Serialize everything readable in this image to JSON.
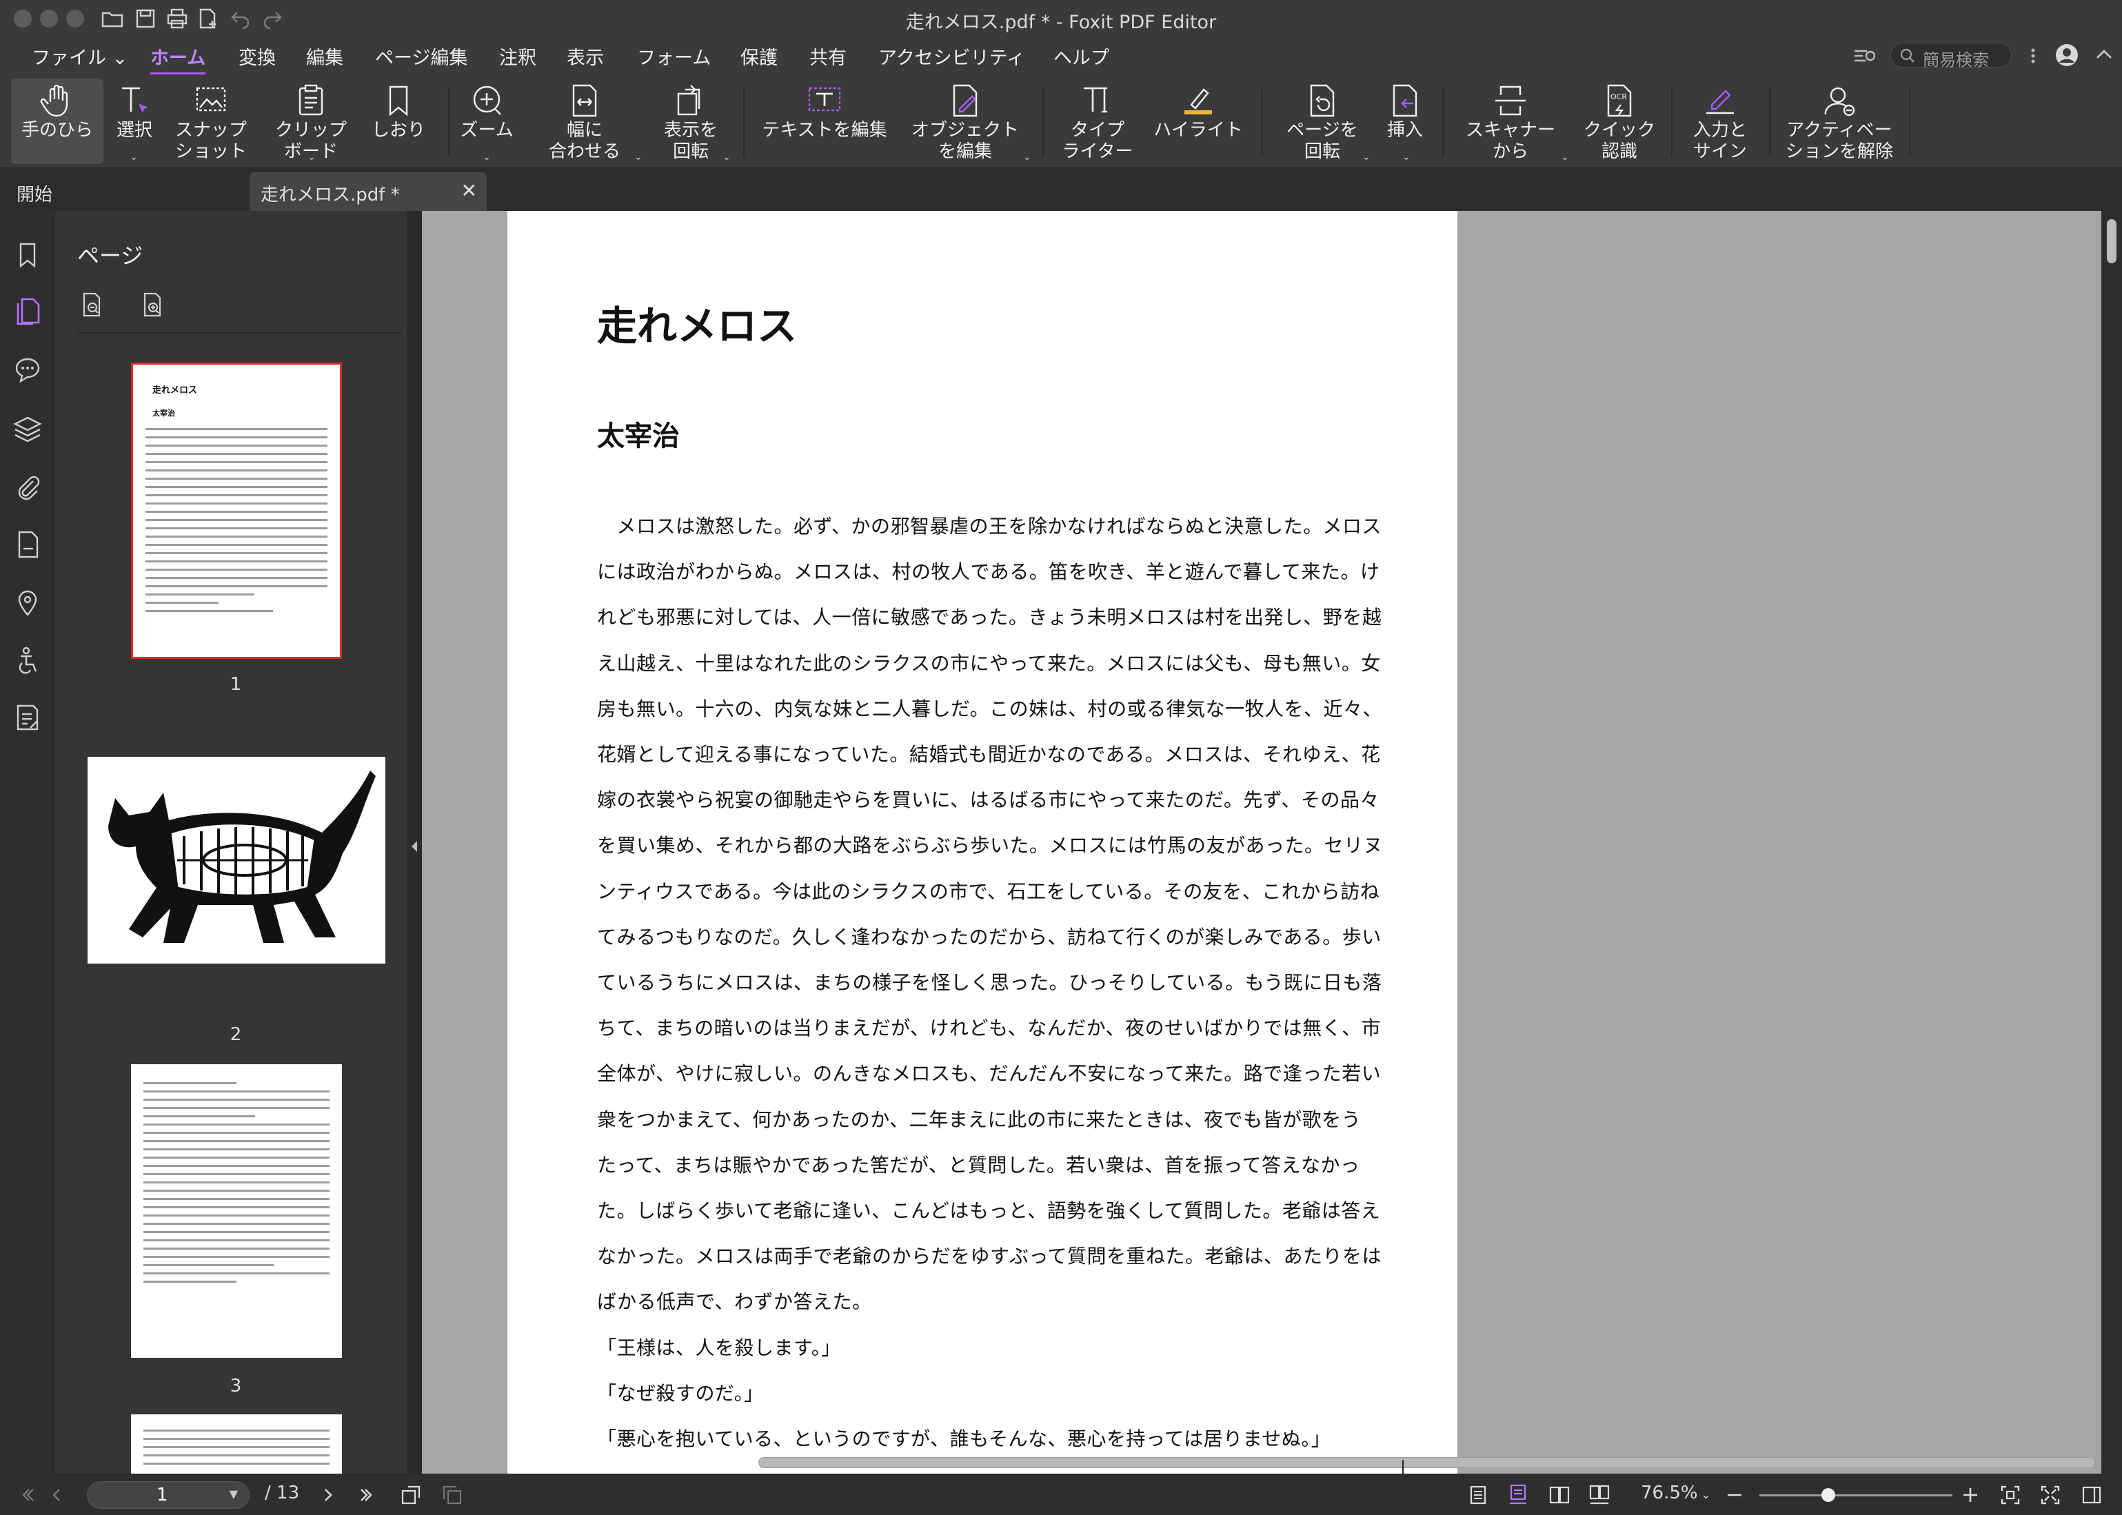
{
  "window": {
    "title": "走れメロス.pdf * - Foxit PDF Editor"
  },
  "menu": {
    "items": [
      "ファイル",
      "ホーム",
      "変換",
      "編集",
      "ページ編集",
      "注釈",
      "表示",
      "フォーム",
      "保護",
      "共有",
      "アクセシビリティ",
      "ヘルプ"
    ],
    "active": "ホーム",
    "search_placeholder": "簡易検索"
  },
  "ribbon": {
    "hand": "手のひら",
    "select": "選択",
    "snapshot": "スナップ\nショット",
    "clipboard": "クリップ\nボード",
    "bookmark": "しおり",
    "zoom": "ズーム",
    "fit_width": "幅に\n合わせる",
    "rotate_view": "表示を\n回転",
    "edit_text": "テキストを編集",
    "edit_object": "オブジェクト\nを編集",
    "typewriter": "タイプ\nライター",
    "highlight": "ハイライト",
    "rotate_page": "ページを\n回転",
    "insert": "挿入",
    "from_scanner": "スキャナー\nから",
    "quick_ocr": "クイック\n認識",
    "fill_sign": "入力と\nサイン",
    "activation": "アクティベー\nションを解除"
  },
  "tabs": {
    "start": "開始",
    "doc": "走れメロス.pdf *"
  },
  "panel": {
    "title": "ページ",
    "thumbnails": [
      "1",
      "2",
      "3"
    ]
  },
  "document": {
    "title": "走れメロス",
    "author": "太宰治",
    "lines": [
      "　メロスは激怒した。必ず、かの邪智暴虐の王を除かなければならぬと決意した。メロス",
      "には政治がわからぬ。メロスは、村の牧人である。笛を吹き、羊と遊んで暮して来た。け",
      "れども邪悪に対しては、人一倍に敏感であった。きょう未明メロスは村を出発し、野を越",
      "え山越え、十里はなれた此のシラクスの市にやって来た。メロスには父も、母も無い。女",
      "房も無い。十六の、内気な妹と二人暮しだ。この妹は、村の或る律気な一牧人を、近々、",
      "花婿として迎える事になっていた。結婚式も間近かなのである。メロスは、それゆえ、花",
      "嫁の衣裳やら祝宴の御馳走やらを買いに、はるばる市にやって来たのだ。先ず、その品々",
      "を買い集め、それから都の大路をぶらぶら歩いた。メロスには竹馬の友があった。セリヌ",
      "ンティウスである。今は此のシラクスの市で、石工をしている。その友を、これから訪ね",
      "てみるつもりなのだ。久しく逢わなかったのだから、訪ねて行くのが楽しみである。歩い",
      "ているうちにメロスは、まちの様子を怪しく思った。ひっそりしている。もう既に日も落",
      "ちて、まちの暗いのは当りまえだが、けれども、なんだか、夜のせいばかりでは無く、市",
      "全体が、やけに寂しい。のんきなメロスも、だんだん不安になって来た。路で逢った若い",
      "衆をつかまえて、何かあったのか、二年まえに此の市に来たときは、夜でも皆が歌をう",
      "たって、まちは賑やかであった筈だが、と質問した。若い衆は、首を振って答えなかっ",
      "た。しばらく歩いて老爺に逢い、こんどはもっと、語勢を強くして質問した。老爺は答え",
      "なかった。メロスは両手で老爺のからだをゆすぶって質問を重ねた。老爺は、あたりをは",
      "ばかる低声で、わずか答えた。",
      "「王様は、人を殺します。」",
      "「なぜ殺すのだ。」",
      "「悪心を抱いている、というのですが、誰もそんな、悪心を持っては居りませぬ。」"
    ]
  },
  "status": {
    "current_page": "1",
    "total_pages": "/ 13",
    "zoom": "76.5%"
  },
  "colors": {
    "accent": "#a55cf5",
    "chrome": "#3a3a3a",
    "canvas": "#a6a6a6",
    "selection": "#e0282a"
  }
}
